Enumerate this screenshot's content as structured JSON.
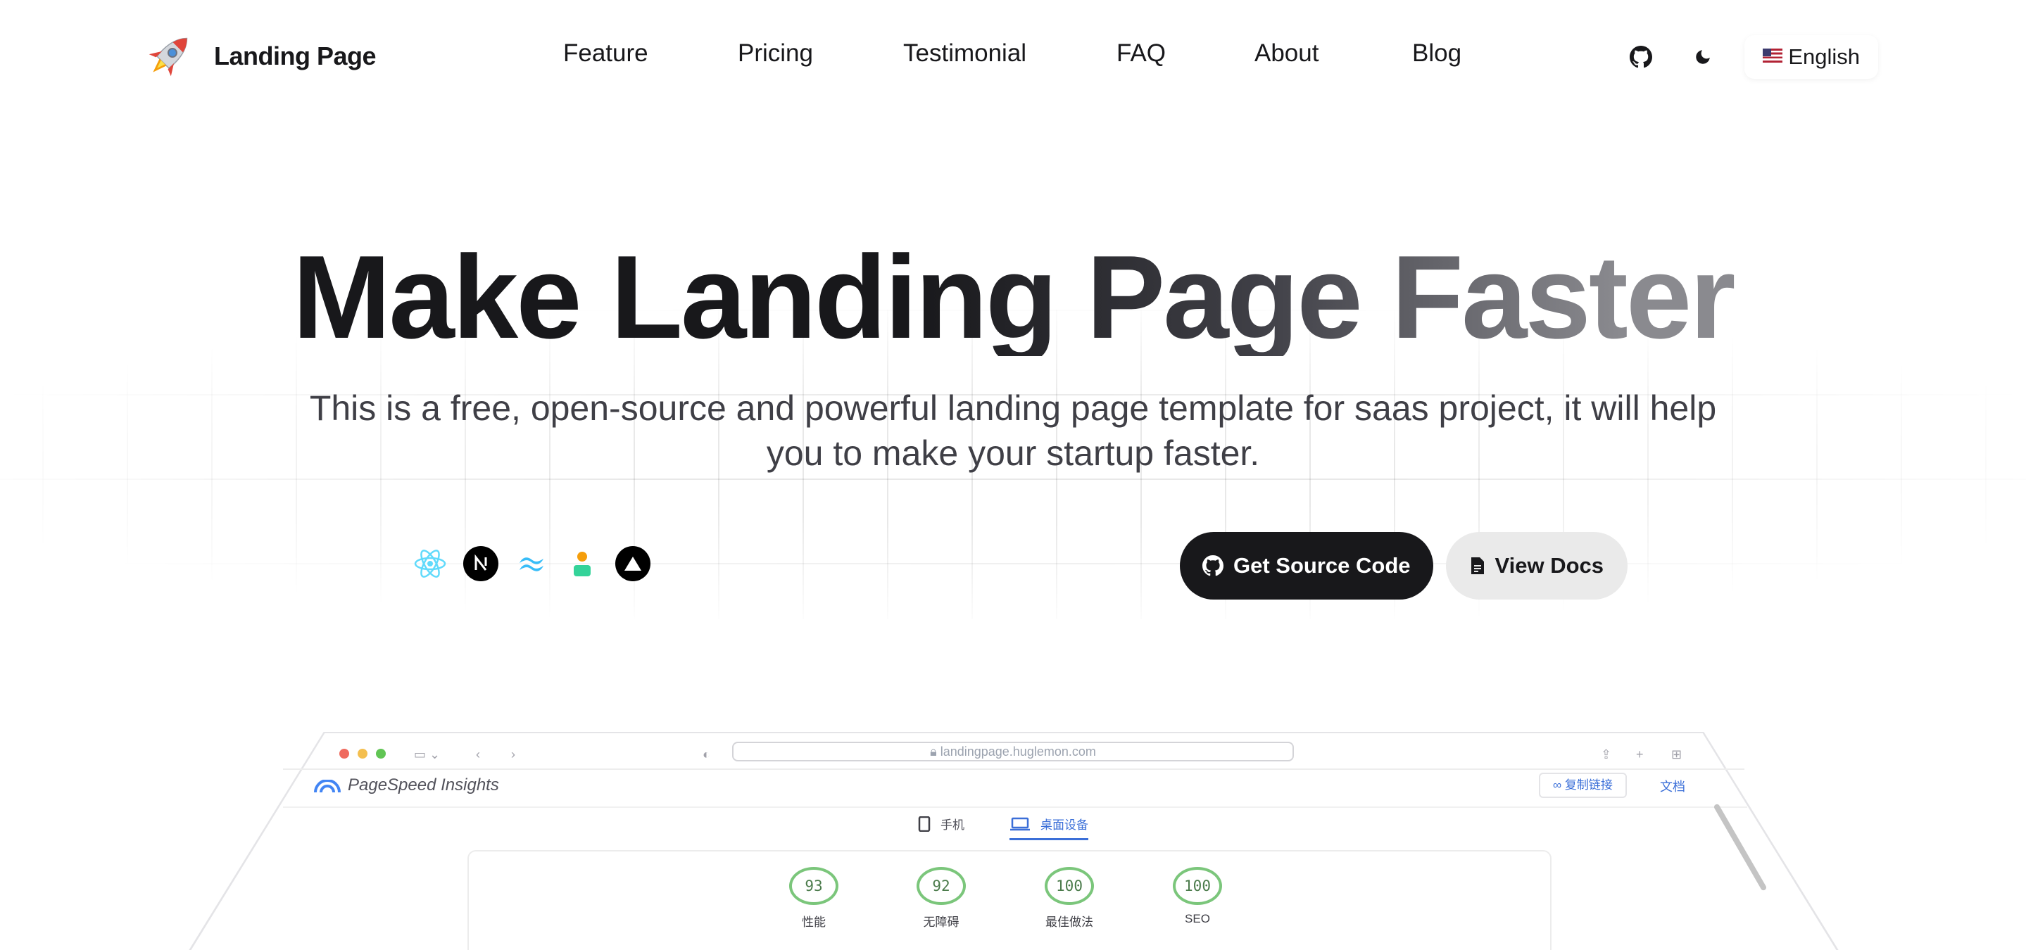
{
  "brand": {
    "name": "Landing Page",
    "logo_icon": "rocket-icon"
  },
  "nav": {
    "links": [
      "Feature",
      "Pricing",
      "Testimonial",
      "FAQ",
      "About",
      "Blog"
    ],
    "github_icon": "github-icon",
    "theme_icon": "moon-icon",
    "language": "English"
  },
  "hero": {
    "title": "Make Landing Page Faster",
    "subtitle": "This is a free, open-source and powerful landing page template for saas project, it will help you to make your startup faster.",
    "tech_icons": [
      "react-icon",
      "nextjs-icon",
      "tailwind-icon",
      "shadcn-icon",
      "vercel-icon"
    ],
    "cta_primary": "Get Source Code",
    "cta_secondary": "View Docs"
  },
  "mockup": {
    "url": "landingpage.huglemon.com",
    "app_title": "PageSpeed Insights",
    "copy_link": "复制链接",
    "docs": "文档",
    "tab_mobile": "手机",
    "tab_desktop": "桌面设备",
    "scores": [
      {
        "value": "93",
        "label": "性能"
      },
      {
        "value": "92",
        "label": "无障碍"
      },
      {
        "value": "100",
        "label": "最佳做法"
      },
      {
        "value": "100",
        "label": "SEO"
      }
    ]
  },
  "colors": {
    "primary": "#18181b",
    "secondary_bg": "#eaeaea",
    "score_green": "#7bc67b",
    "link_blue": "#3b6fd8"
  }
}
